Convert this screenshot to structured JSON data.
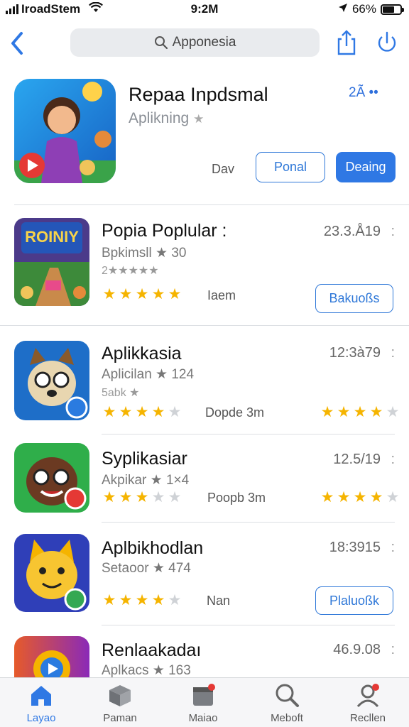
{
  "status": {
    "carrier": "IroadStem",
    "time": "9:2M",
    "battery": "66%",
    "battery_level": 0.66
  },
  "search": {
    "placeholder": "Apponesia"
  },
  "featured": {
    "title": "Repaa Inpdsmal",
    "subtitle": "Aplikning",
    "meta": "2Ã ••",
    "dav_label": "Dav",
    "outline_button": "Ponal",
    "primary_button": "Deaing"
  },
  "apps": [
    {
      "name": "Popia Poplular :",
      "date": "23.3.Å19",
      "sub": "Bpkimsll ★ 30",
      "sub2": "2★★★★★",
      "mid": "Iaem",
      "button": "Bakuoßs",
      "rating": 5,
      "logo_text": "ROINIY"
    },
    {
      "name": "Aplikkasia",
      "date": "12:3à79",
      "sub": "Aplicilan ★ 124",
      "sub2": "5abk ★",
      "mid": "Dopde 3m",
      "rating": 3.5,
      "right_rating": 3.5
    },
    {
      "name": "Syplikasiar",
      "date": "12.5/19",
      "sub": "Akpikar ★ 1×4",
      "mid": "Poopb 3m",
      "rating": 3,
      "right_rating": 3.5
    },
    {
      "name": "Aplbikhodlan",
      "date": "18:3915",
      "sub": "Setaoor ★ 474",
      "mid": "Nan",
      "button": "Plaluoßk",
      "rating": 4
    },
    {
      "name": "Renlaakadaı",
      "date": "46.9.08",
      "sub": "Aplkacs ★ 163"
    }
  ],
  "more_label": ":",
  "tabs": [
    {
      "label": "Layao",
      "icon": "home-icon"
    },
    {
      "label": "Paman",
      "icon": "box-icon"
    },
    {
      "label": "Maiao",
      "icon": "calendar-icon"
    },
    {
      "label": "Meboft",
      "icon": "search-icon"
    },
    {
      "label": "Recllen",
      "icon": "person-icon"
    }
  ],
  "colors": {
    "accent": "#2f78e4",
    "star": "#f5b400"
  }
}
